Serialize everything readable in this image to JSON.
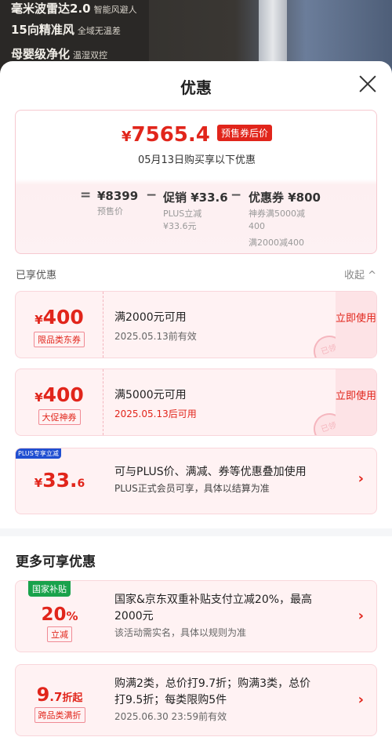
{
  "background": {
    "lines": [
      {
        "main": "毫米波雷达2.0",
        "sub": "智能风避人"
      },
      {
        "main": "15向精准风",
        "sub": "全域无温差"
      },
      {
        "main": "母婴级净化",
        "sub": "温湿双控"
      }
    ]
  },
  "sheet": {
    "title": "优惠"
  },
  "price_card": {
    "currency": "¥",
    "price": "7565.4",
    "tag": "预售券后价",
    "subtitle": "05月13日购买享以下优惠",
    "eq": "=",
    "minus": "−",
    "base_price": "¥8399",
    "base_label": "预售价",
    "promo_title": "促销",
    "promo_amount": "¥33.6",
    "promo_desc1": "PLUS立减",
    "promo_desc2": "¥33.6元",
    "coupon_title": "优惠券",
    "coupon_amount": "¥800",
    "coupon_desc1": "神券满5000减",
    "coupon_desc2": "400",
    "coupon_desc3": "满2000减400"
  },
  "enjoyed": {
    "title": "已享优惠",
    "fold_label": "收起 ^"
  },
  "coupons": [
    {
      "currency": "¥",
      "amount": "400",
      "label": "限品类东券",
      "condition": "满2000元可用",
      "date": "2025.05.13前有效",
      "use": "立即使用",
      "stamp": "已领"
    },
    {
      "currency": "¥",
      "amount": "400",
      "label": "大促神券",
      "condition": "满5000元可用",
      "date": "2025.05.13后可用",
      "use": "立即使用",
      "stamp": "已领"
    }
  ],
  "plus_card": {
    "tag": "PLUS专享立减",
    "currency": "¥",
    "amount": "33.",
    "amount_dec": "6",
    "line1": "可与PLUS价、满减、券等优惠叠加使用",
    "line2": "PLUS正式会员可享，具体以结算为准",
    "arrow": "›"
  },
  "more": {
    "title": "更多可享优惠"
  },
  "national_card": {
    "tag": "国家补贴",
    "value": "20",
    "unit": "%",
    "label": "立减",
    "line1": "国家&京东双重补贴支付立减20%，最高",
    "line2": "2000元",
    "line3": "该活动需实名，具体以规则为准",
    "arrow": "›"
  },
  "discount_card": {
    "value": "9",
    "value_dec": ".7",
    "unit": "折起",
    "label": "跨品类满折",
    "line1": "购满2类，总价打9.7折；购满3类，总价",
    "line2": "打9.5折；每类限购5件",
    "line3": "2025.06.30 23:59前有效",
    "arrow": "›"
  },
  "colors": {
    "accent": "#e1251b",
    "card_bg": "#fff2f3",
    "plus_blue": "#1f4fd1",
    "national_green": "#19a24b"
  }
}
